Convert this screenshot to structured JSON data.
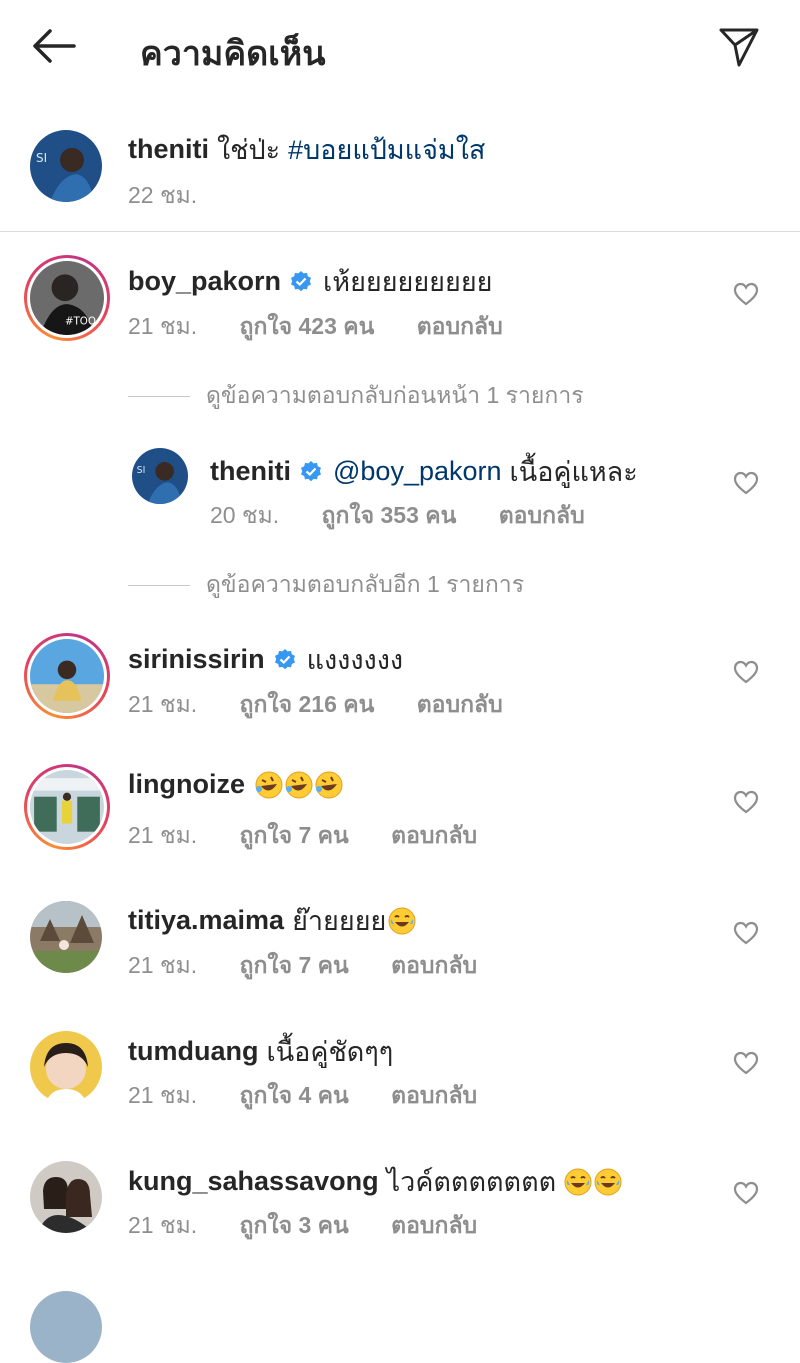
{
  "header": {
    "title": "ความคิดเห็น"
  },
  "caption": {
    "username": "theniti",
    "text": "ใช่ป่ะ",
    "hashtag": "#บอยแป้มแจ่มใส",
    "time": "22 ชม."
  },
  "comments": [
    {
      "username": "boy_pakorn",
      "verified": true,
      "text": "เห้ยยยยยยยยย",
      "time": "21 ชม.",
      "likes": "ถูกใจ 423 คน",
      "reply": "ตอบกลับ"
    },
    {
      "username": "sirinissirin",
      "verified": true,
      "text": "แงงงงงง",
      "time": "21 ชม.",
      "likes": "ถูกใจ 216 คน",
      "reply": "ตอบกลับ"
    },
    {
      "username": "lingnoize",
      "verified": false,
      "text": "",
      "time": "21 ชม.",
      "likes": "ถูกใจ 7 คน",
      "reply": "ตอบกลับ"
    },
    {
      "username": "titiya.maima",
      "verified": false,
      "text": "ย๊ายยยย",
      "time": "21 ชม.",
      "likes": "ถูกใจ 7 คน",
      "reply": "ตอบกลับ"
    },
    {
      "username": "tumduang",
      "verified": false,
      "text": "เนื้อคู่ชัดๆๆ",
      "time": "21 ชม.",
      "likes": "ถูกใจ 4 คน",
      "reply": "ตอบกลับ"
    },
    {
      "username": "kung_sahassavong",
      "verified": false,
      "text": "ไวค์ตตตตตตต",
      "time": "21 ชม.",
      "likes": "ถูกใจ 3 คน",
      "reply": "ตอบกลับ"
    }
  ],
  "replies": {
    "view_previous": "ดูข้อความตอบกลับก่อนหน้า 1 รายการ",
    "view_more": "ดูข้อความตอบกลับอีก 1 รายการ",
    "reply": {
      "username": "theniti",
      "verified": true,
      "mention": "@boy_pakorn",
      "text": "เนื้อคู่แหละ",
      "time": "20 ชม.",
      "likes": "ถูกใจ 353 คน",
      "reply": "ตอบกลับ"
    }
  },
  "icons": {
    "back": "arrow-left-icon",
    "send": "paper-plane-icon",
    "verified": "verified-badge-icon",
    "heart": "heart-outline-icon",
    "emoji_rofl": "rolling-laughing-emoji",
    "emoji_joy": "tears-of-joy-emoji"
  },
  "colors": {
    "link": "#00376b",
    "verified": "#3897f0",
    "meta": "#8e8e8e",
    "text": "#262626"
  }
}
